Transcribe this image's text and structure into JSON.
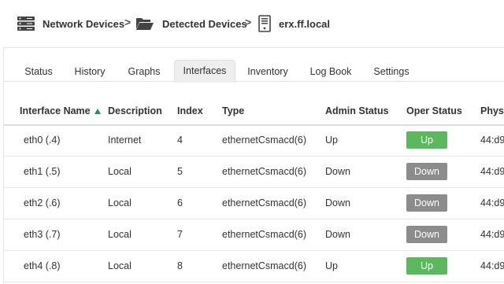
{
  "breadcrumb": {
    "items": [
      {
        "label": "Network Devices",
        "icon": "server-stack-icon"
      },
      {
        "label": "Detected Devices",
        "icon": "folder-open-icon"
      },
      {
        "label": "erx.ff.local",
        "icon": "device-tower-icon"
      }
    ],
    "separator": ">"
  },
  "tabs": [
    {
      "label": "Status",
      "active": false
    },
    {
      "label": "History",
      "active": false
    },
    {
      "label": "Graphs",
      "active": false
    },
    {
      "label": "Interfaces",
      "active": true
    },
    {
      "label": "Inventory",
      "active": false
    },
    {
      "label": "Log Book",
      "active": false
    },
    {
      "label": "Settings",
      "active": false
    }
  ],
  "table": {
    "columns": [
      "Interface Name",
      "Description",
      "Index",
      "Type",
      "Admin Status",
      "Oper Status",
      "Phys"
    ],
    "sort": {
      "column": "Interface Name",
      "direction": "ascending"
    },
    "rows": [
      {
        "name": "eth0 (.4)",
        "description": "Internet",
        "index": "4",
        "type": "ethernetCsmacd(6)",
        "admin": "Up",
        "oper": "Up",
        "phys": "44:d9"
      },
      {
        "name": "eth1 (.5)",
        "description": "Local",
        "index": "5",
        "type": "ethernetCsmacd(6)",
        "admin": "Down",
        "oper": "Down",
        "phys": "44:d9"
      },
      {
        "name": "eth2 (.6)",
        "description": "Local",
        "index": "6",
        "type": "ethernetCsmacd(6)",
        "admin": "Down",
        "oper": "Down",
        "phys": "44:d9"
      },
      {
        "name": "eth3 (.7)",
        "description": "Local",
        "index": "7",
        "type": "ethernetCsmacd(6)",
        "admin": "Down",
        "oper": "Down",
        "phys": "44:d9"
      },
      {
        "name": "eth4 (.8)",
        "description": "Local",
        "index": "8",
        "type": "ethernetCsmacd(6)",
        "admin": "Up",
        "oper": "Up",
        "phys": "44:d9"
      }
    ]
  },
  "colors": {
    "status_up": "#5cb85c",
    "status_down": "#8c8c8c",
    "sort_arrow": "#2e8b57"
  }
}
